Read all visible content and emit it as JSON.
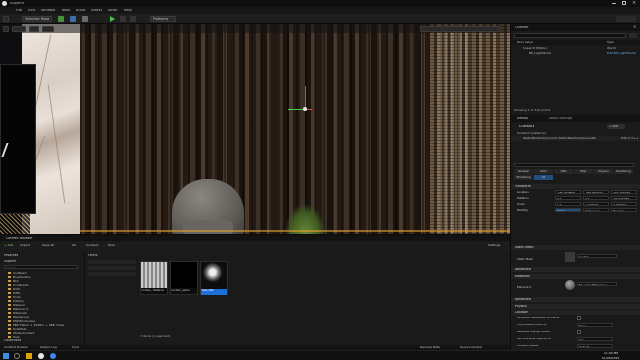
{
  "title_bar": {
    "project": "Supernf"
  },
  "menu": [
    "File",
    "Edit",
    "Window",
    "Tools",
    "Build",
    "Select",
    "Actor",
    "Help"
  ],
  "toolbar": {
    "mode": "Selection Mode",
    "platforms": "Platforms"
  },
  "outliner": {
    "title": "Outliner",
    "columns": [
      "Item Label",
      "Type"
    ],
    "rows": [
      {
        "label": "Supernf (Editor)",
        "type": "World"
      },
      {
        "label": "BP_LightStudio",
        "type": "Edit BP_LightStudio"
      }
    ],
    "footer": "Showing 1 of 316 actors"
  },
  "details": {
    "tabs": [
      "Details",
      "World Settings"
    ],
    "object": "Curtain3",
    "add_button": "+ Add",
    "component_root": "Curtain3 (Instance)",
    "component_child": "StaticMeshComponent (StaticMeshComponent0)",
    "component_child_type": "Edit in C++",
    "filter_tabs": [
      "General",
      "Actor",
      "LOD",
      "Misc",
      "Physics",
      "Rendering",
      "Streaming",
      "All"
    ],
    "sections": {
      "transform": "Transform",
      "static_mesh_section": "Static Mesh",
      "advanced": "Advanced",
      "materials": "Materials",
      "physics": "Physics",
      "collision": "Collision"
    },
    "transform": {
      "location_label": "Location",
      "location": [
        "-381.959808",
        "-784.869019",
        "794.493296"
      ],
      "rotation_label": "Rotation",
      "rotation": [
        "0.0",
        "0.0",
        "-89.999939"
      ],
      "scale_label": "Scale",
      "scale": [
        "1.0",
        "1.199000",
        "2.739334"
      ],
      "mobility_label": "Mobility",
      "mobility": [
        "Static",
        "Stationary",
        "Movable"
      ]
    },
    "static_mesh_label": "Static Mesh",
    "static_mesh_value": "Curtain",
    "element_label": "Element 0",
    "element_value": "Mi_walnutMaterial_s",
    "collision_rows": [
      {
        "label": "Simulation Generates Hit Events",
        "value": ""
      },
      {
        "label": "Phys Material Override",
        "value": "None"
      },
      {
        "label": "Generate Overlap Events",
        "value": ""
      },
      {
        "label": "Can Character Step Up On",
        "value": "Yes"
      },
      {
        "label": "Collision Presets",
        "value": "Default"
      },
      {
        "label": "Generate Overlap Events During Level Streaming",
        "value": ""
      }
    ]
  },
  "content_browser": {
    "tab": "Content Browser",
    "add_button": "+ Add",
    "import_button": "Import",
    "save_button": "Save All",
    "path": [
      "All",
      "Content",
      "Tuile"
    ],
    "settings": "Settings",
    "favorites": "Favorites",
    "project": "Supernf",
    "search_placeholder": "Search",
    "folders": [
      "AnnBeam",
      "Brushbotton",
      "BLK",
      "ContentAA",
      "DCM",
      "DZEL",
      "Fonts",
      "Kitchen",
      "Material",
      "Material_0",
      "MaterialA",
      "Megascans",
      "MWWCorbusier",
      "PBR_Fabrik_1_2048m_+_PBR_maps",
      "TuileMats",
      "StarterContent",
      "Tuile"
    ],
    "filters_label": "Filters",
    "assets": [
      {
        "name": "Curtain_ Material",
        "kind": "curtain"
      },
      {
        "name": "Curtain_alpha",
        "kind": "black"
      },
      {
        "name": "Tuile_Mat",
        "kind": "sphere",
        "selected": true
      }
    ],
    "status": "3 items (1 selected)",
    "collections": "Collections"
  },
  "status_bar": {
    "items": [
      "Content Drawer",
      "Output Log",
      "Cmd"
    ],
    "right": [
      "Derived Data",
      "Source Control"
    ]
  },
  "taskbar": {
    "clock": "11:00 PM",
    "date": "01/05/2023"
  }
}
